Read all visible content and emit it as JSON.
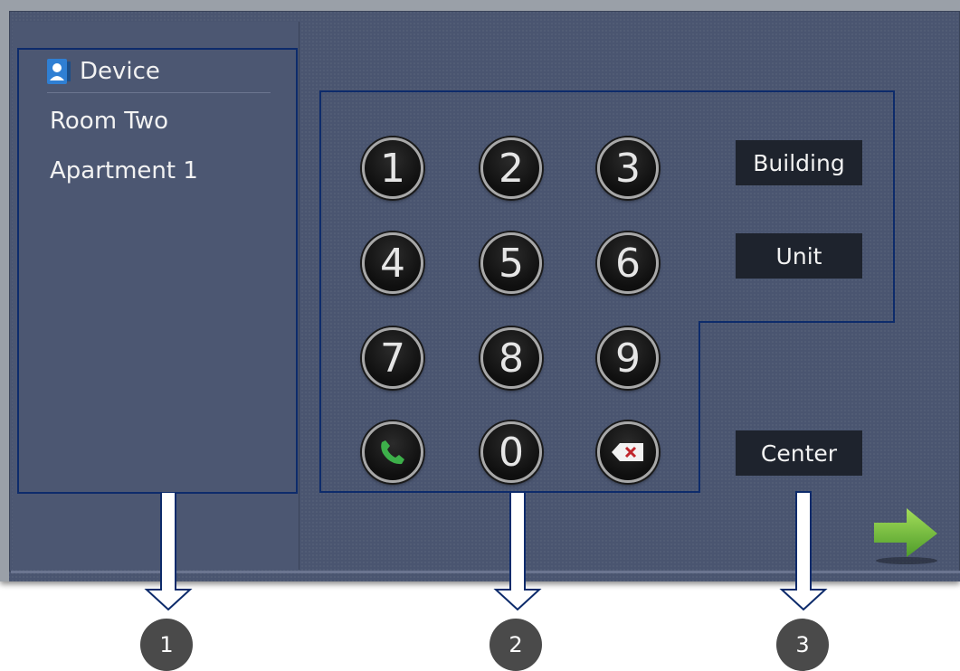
{
  "device_list": {
    "title": "Device",
    "items": [
      "Room Two",
      "Apartment 1"
    ]
  },
  "keypad": {
    "keys": [
      "1",
      "2",
      "3",
      "4",
      "5",
      "6",
      "7",
      "8",
      "9",
      "0"
    ],
    "call_icon": "phone-icon",
    "delete_icon": "backspace-icon"
  },
  "buttons": {
    "building": "Building",
    "unit": "Unit",
    "center": "Center"
  },
  "next_icon": "arrow-right-icon",
  "badges": [
    "1",
    "2",
    "3"
  ],
  "colors": {
    "background": "#4a5570",
    "outline": "#0d2b6b",
    "call_green": "#3db04a",
    "delete_red": "#c0262c",
    "arrow_green": "#7ac943"
  }
}
